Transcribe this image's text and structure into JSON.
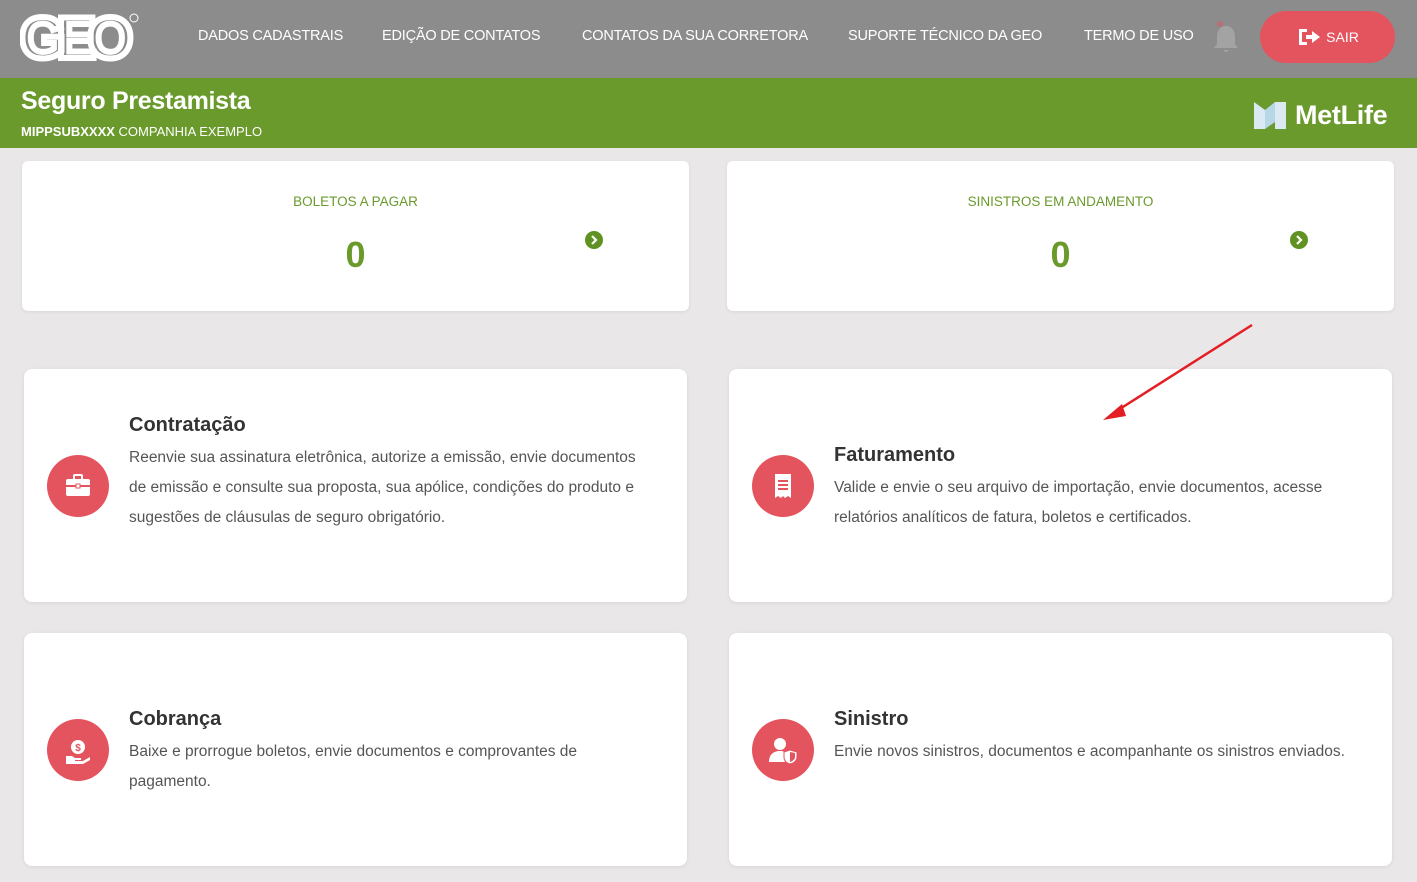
{
  "nav": {
    "logo_text": "GEO",
    "links": [
      "DADOS CADASTRAIS",
      "EDIÇÃO DE CONTATOS",
      "CONTATOS DA SUA CORRETORA",
      "SUPORTE TÉCNICO DA GEO",
      "TERMO DE USO"
    ],
    "logout_label": "SAIR"
  },
  "header": {
    "title": "Seguro Prestamista",
    "policy_code": "MIPPSUBXXXX",
    "company": "COMPANHIA EXEMPLO",
    "brand": "MetLife"
  },
  "stats": [
    {
      "label": "BOLETOS A PAGAR",
      "value": "0"
    },
    {
      "label": "SINISTROS EM ANDAMENTO",
      "value": "0"
    }
  ],
  "features": [
    {
      "title": "Contratação",
      "description": "Reenvie sua assinatura eletrônica, autorize a emissão, envie documentos de emissão e consulte sua proposta, sua apólice, condições do produto e sugestões de cláusulas de seguro obrigatório.",
      "icon": "briefcase-icon"
    },
    {
      "title": "Faturamento",
      "description": "Valide e envie o seu arquivo de importação, envie documentos, acesse relatórios analíticos de fatura, boletos e certificados.",
      "icon": "receipt-icon"
    },
    {
      "title": "Cobrança",
      "description": "Baixe e prorrogue boletos, envie documentos e comprovantes de pagamento.",
      "icon": "money-hand-icon"
    },
    {
      "title": "Sinistro",
      "description": "Envie novos sinistros, documentos e acompanhante os sinistros enviados.",
      "icon": "user-shield-icon"
    }
  ],
  "colors": {
    "nav_bg": "#8c8c8c",
    "brand_green": "#6a9a2c",
    "accent_red": "#e4545e",
    "page_bg": "#e9e7e8",
    "annotation_arrow": "#e31e24"
  }
}
